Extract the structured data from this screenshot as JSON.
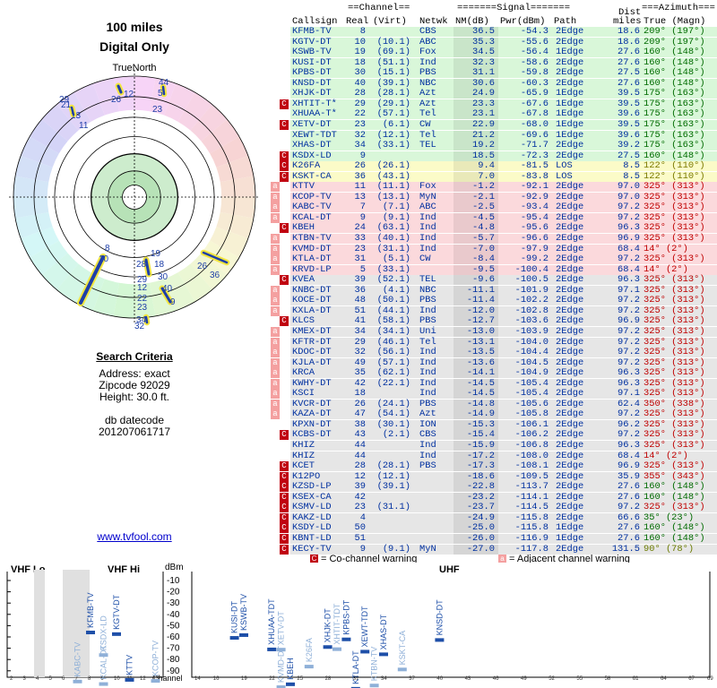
{
  "title": "100 miles",
  "subtitle": "Digital Only",
  "truenorth_label": "TrueNorth",
  "search": {
    "heading": "Search Criteria",
    "address": "Address: exact",
    "zipcode": "Zipcode 92029",
    "height": "Height: 30.0 ft.",
    "db_label": "db datecode",
    "db_value": "201207061717"
  },
  "site_link": "www.tvfool.com",
  "columns": {
    "group_channel": "==Channel==",
    "group_signal": "=======Signal=======",
    "group_azimuth": "===Azimuth===",
    "callsign": "Callsign",
    "real": "Real",
    "virt": "(Virt)",
    "netwk": "Netwk",
    "nm": "NM(dB)",
    "pwr": "Pwr(dBm)",
    "path": "Path",
    "dist1": "Dist",
    "dist2": "miles",
    "true_magn": "True (Magn)"
  },
  "colors": {
    "green": "#d9f7d9",
    "yellow": "#fbfbc8",
    "pink": "#fbd9dc",
    "gray": "#e6e6e6",
    "badge_co": "#c0000f",
    "badge_adj": "#f4a0a0"
  },
  "stations": [
    {
      "call": "KFMB-TV",
      "real": "8",
      "virt": "",
      "net": "CBS",
      "nm": "36.5",
      "pwr": "-54.3",
      "path": "2Edge",
      "dist": "18.6",
      "az": "209° (197°)",
      "band": "green",
      "badge": ""
    },
    {
      "call": "KGTV-DT",
      "real": "10",
      "virt": "(10.1)",
      "net": "ABC",
      "nm": "35.3",
      "pwr": "-55.6",
      "path": "2Edge",
      "dist": "18.6",
      "az": "209° (197°)",
      "band": "green",
      "badge": ""
    },
    {
      "call": "KSWB-TV",
      "real": "19",
      "virt": "(69.1)",
      "net": "Fox",
      "nm": "34.5",
      "pwr": "-56.4",
      "path": "1Edge",
      "dist": "27.6",
      "az": "160° (148°)",
      "band": "green",
      "badge": ""
    },
    {
      "call": "KUSI-DT",
      "real": "18",
      "virt": "(51.1)",
      "net": "Ind",
      "nm": "32.3",
      "pwr": "-58.6",
      "path": "2Edge",
      "dist": "27.6",
      "az": "160° (148°)",
      "band": "green",
      "badge": ""
    },
    {
      "call": "KPBS-DT",
      "real": "30",
      "virt": "(15.1)",
      "net": "PBS",
      "nm": "31.1",
      "pwr": "-59.8",
      "path": "2Edge",
      "dist": "27.5",
      "az": "160° (148°)",
      "band": "green",
      "badge": ""
    },
    {
      "call": "KNSD-DT",
      "real": "40",
      "virt": "(39.1)",
      "net": "NBC",
      "nm": "30.6",
      "pwr": "-60.3",
      "path": "2Edge",
      "dist": "27.6",
      "az": "160° (148°)",
      "band": "green",
      "badge": ""
    },
    {
      "call": "XHJK-DT",
      "real": "28",
      "virt": "(28.1)",
      "net": "Azt",
      "nm": "24.9",
      "pwr": "-65.9",
      "path": "1Edge",
      "dist": "39.5",
      "az": "175° (163°)",
      "band": "green",
      "badge": ""
    },
    {
      "call": "XHTIT-T*",
      "real": "29",
      "virt": "(29.1)",
      "net": "Azt",
      "nm": "23.3",
      "pwr": "-67.6",
      "path": "1Edge",
      "dist": "39.5",
      "az": "175° (163°)",
      "band": "green",
      "badge": "co"
    },
    {
      "call": "XHUAA-T*",
      "real": "22",
      "virt": "(57.1)",
      "net": "Tel",
      "nm": "23.1",
      "pwr": "-67.8",
      "path": "1Edge",
      "dist": "39.6",
      "az": "175° (163°)",
      "band": "green",
      "badge": ""
    },
    {
      "call": "XETV-DT",
      "real": "23",
      "virt": "(6.1)",
      "net": "CW",
      "nm": "22.9",
      "pwr": "-68.0",
      "path": "1Edge",
      "dist": "39.5",
      "az": "175° (163°)",
      "band": "green",
      "badge": "co"
    },
    {
      "call": "XEWT-TDT",
      "real": "32",
      "virt": "(12.1)",
      "net": "Tel",
      "nm": "21.2",
      "pwr": "-69.6",
      "path": "1Edge",
      "dist": "39.6",
      "az": "175° (163°)",
      "band": "green",
      "badge": ""
    },
    {
      "call": "XHAS-DT",
      "real": "34",
      "virt": "(33.1)",
      "net": "TEL",
      "nm": "19.2",
      "pwr": "-71.7",
      "path": "2Edge",
      "dist": "39.2",
      "az": "175° (163°)",
      "band": "green",
      "badge": ""
    },
    {
      "call": "KSDX-LD",
      "real": "9",
      "virt": "",
      "net": "",
      "nm": "18.5",
      "pwr": "-72.3",
      "path": "2Edge",
      "dist": "27.5",
      "az": "160° (148°)",
      "band": "green",
      "badge": "co"
    },
    {
      "call": "K26FA",
      "real": "26",
      "virt": "(26.1)",
      "net": "",
      "nm": "9.4",
      "pwr": "-81.5",
      "path": "LOS",
      "dist": "8.5",
      "az": "122° (110°)",
      "band": "yellow",
      "badge": "co"
    },
    {
      "call": "KSKT-CA",
      "real": "36",
      "virt": "(43.1)",
      "net": "",
      "nm": "7.0",
      "pwr": "-83.8",
      "path": "LOS",
      "dist": "8.5",
      "az": "122° (110°)",
      "band": "yellow",
      "badge": "co"
    },
    {
      "call": "KTTV",
      "real": "11",
      "virt": "(11.1)",
      "net": "Fox",
      "nm": "-1.2",
      "pwr": "-92.1",
      "path": "2Edge",
      "dist": "97.0",
      "az": "325° (313°)",
      "band": "pink",
      "badge": "adj"
    },
    {
      "call": "KCOP-TV",
      "real": "13",
      "virt": "(13.1)",
      "net": "MyN",
      "nm": "-2.1",
      "pwr": "-92.9",
      "path": "2Edge",
      "dist": "97.0",
      "az": "325° (313°)",
      "band": "pink",
      "badge": "adj"
    },
    {
      "call": "KABC-TV",
      "real": "7",
      "virt": "(7.1)",
      "net": "ABC",
      "nm": "-2.5",
      "pwr": "-93.4",
      "path": "2Edge",
      "dist": "97.2",
      "az": "325° (313°)",
      "band": "pink",
      "badge": "adj"
    },
    {
      "call": "KCAL-DT",
      "real": "9",
      "virt": "(9.1)",
      "net": "Ind",
      "nm": "-4.5",
      "pwr": "-95.4",
      "path": "2Edge",
      "dist": "97.2",
      "az": "325° (313°)",
      "band": "pink",
      "badge": "adj"
    },
    {
      "call": "KBEH",
      "real": "24",
      "virt": "(63.1)",
      "net": "Ind",
      "nm": "-4.8",
      "pwr": "-95.6",
      "path": "2Edge",
      "dist": "96.3",
      "az": "325° (313°)",
      "band": "pink",
      "badge": "co"
    },
    {
      "call": "KTBN-TV",
      "real": "33",
      "virt": "(40.1)",
      "net": "Ind",
      "nm": "-5.7",
      "pwr": "-96.6",
      "path": "2Edge",
      "dist": "96.9",
      "az": "325° (313°)",
      "band": "pink",
      "badge": "adj"
    },
    {
      "call": "KVMD-DT",
      "real": "23",
      "virt": "(31.1)",
      "net": "Ind",
      "nm": "-7.0",
      "pwr": "-97.9",
      "path": "2Edge",
      "dist": "68.4",
      "az": "14° (2°)",
      "band": "pink",
      "badge": "adj"
    },
    {
      "call": "KTLA-DT",
      "real": "31",
      "virt": "(5.1)",
      "net": "CW",
      "nm": "-8.4",
      "pwr": "-99.2",
      "path": "2Edge",
      "dist": "97.2",
      "az": "325° (313°)",
      "band": "pink",
      "badge": "adj"
    },
    {
      "call": "KRVD-LP",
      "real": "5",
      "virt": "(33.1)",
      "net": "",
      "nm": "-9.5",
      "pwr": "-100.4",
      "path": "2Edge",
      "dist": "68.4",
      "az": "14° (2°)",
      "band": "pink",
      "badge": "adj"
    },
    {
      "call": "KVEA",
      "real": "39",
      "virt": "(52.1)",
      "net": "TEL",
      "nm": "-9.6",
      "pwr": "-100.5",
      "path": "2Edge",
      "dist": "96.3",
      "az": "325° (313°)",
      "band": "gray",
      "badge": "co"
    },
    {
      "call": "KNBC-DT",
      "real": "36",
      "virt": "(4.1)",
      "net": "NBC",
      "nm": "-11.1",
      "pwr": "-101.9",
      "path": "2Edge",
      "dist": "97.1",
      "az": "325° (313°)",
      "band": "gray",
      "badge": "adj"
    },
    {
      "call": "KOCE-DT",
      "real": "48",
      "virt": "(50.1)",
      "net": "PBS",
      "nm": "-11.4",
      "pwr": "-102.2",
      "path": "2Edge",
      "dist": "97.2",
      "az": "325° (313°)",
      "band": "gray",
      "badge": "adj"
    },
    {
      "call": "KXLA-DT",
      "real": "51",
      "virt": "(44.1)",
      "net": "Ind",
      "nm": "-12.0",
      "pwr": "-102.8",
      "path": "2Edge",
      "dist": "97.2",
      "az": "325° (313°)",
      "band": "gray",
      "badge": "adj"
    },
    {
      "call": "KLCS",
      "real": "41",
      "virt": "(58.1)",
      "net": "PBS",
      "nm": "-12.7",
      "pwr": "-103.6",
      "path": "2Edge",
      "dist": "96.9",
      "az": "325° (313°)",
      "band": "gray",
      "badge": "co"
    },
    {
      "call": "KMEX-DT",
      "real": "34",
      "virt": "(34.1)",
      "net": "Uni",
      "nm": "-13.0",
      "pwr": "-103.9",
      "path": "2Edge",
      "dist": "97.2",
      "az": "325° (313°)",
      "band": "gray",
      "badge": "adj"
    },
    {
      "call": "KFTR-DT",
      "real": "29",
      "virt": "(46.1)",
      "net": "Tel",
      "nm": "-13.1",
      "pwr": "-104.0",
      "path": "2Edge",
      "dist": "97.2",
      "az": "325° (313°)",
      "band": "gray",
      "badge": "adj"
    },
    {
      "call": "KDOC-DT",
      "real": "32",
      "virt": "(56.1)",
      "net": "Ind",
      "nm": "-13.5",
      "pwr": "-104.4",
      "path": "2Edge",
      "dist": "97.2",
      "az": "325° (313°)",
      "band": "gray",
      "badge": "adj"
    },
    {
      "call": "KJLA-DT",
      "real": "49",
      "virt": "(57.1)",
      "net": "Ind",
      "nm": "-13.6",
      "pwr": "-104.5",
      "path": "2Edge",
      "dist": "97.2",
      "az": "325° (313°)",
      "band": "gray",
      "badge": "adj"
    },
    {
      "call": "KRCA",
      "real": "35",
      "virt": "(62.1)",
      "net": "Ind",
      "nm": "-14.1",
      "pwr": "-104.9",
      "path": "2Edge",
      "dist": "96.3",
      "az": "325° (313°)",
      "band": "gray",
      "badge": "adj"
    },
    {
      "call": "KWHY-DT",
      "real": "42",
      "virt": "(22.1)",
      "net": "Ind",
      "nm": "-14.5",
      "pwr": "-105.4",
      "path": "2Edge",
      "dist": "96.3",
      "az": "325° (313°)",
      "band": "gray",
      "badge": "adj"
    },
    {
      "call": "KSCI",
      "real": "18",
      "virt": "",
      "net": "Ind",
      "nm": "-14.5",
      "pwr": "-105.4",
      "path": "2Edge",
      "dist": "97.1",
      "az": "325° (313°)",
      "band": "gray",
      "badge": "adj"
    },
    {
      "call": "KVCR-DT",
      "real": "26",
      "virt": "(24.1)",
      "net": "PBS",
      "nm": "-14.8",
      "pwr": "-105.6",
      "path": "2Edge",
      "dist": "62.4",
      "az": "350° (338°)",
      "band": "gray",
      "badge": "adj"
    },
    {
      "call": "KAZA-DT",
      "real": "47",
      "virt": "(54.1)",
      "net": "Azt",
      "nm": "-14.9",
      "pwr": "-105.8",
      "path": "2Edge",
      "dist": "97.2",
      "az": "325° (313°)",
      "band": "gray",
      "badge": "adj"
    },
    {
      "call": "KPXN-DT",
      "real": "38",
      "virt": "(30.1)",
      "net": "ION",
      "nm": "-15.3",
      "pwr": "-106.1",
      "path": "2Edge",
      "dist": "96.2",
      "az": "325° (313°)",
      "band": "gray",
      "badge": ""
    },
    {
      "call": "KCBS-DT",
      "real": "43",
      "virt": "(2.1)",
      "net": "CBS",
      "nm": "-15.4",
      "pwr": "-106.2",
      "path": "2Edge",
      "dist": "97.2",
      "az": "325° (313°)",
      "band": "gray",
      "badge": "co"
    },
    {
      "call": "KHIZ",
      "real": "44",
      "virt": "",
      "net": "Ind",
      "nm": "-15.9",
      "pwr": "-106.8",
      "path": "2Edge",
      "dist": "96.3",
      "az": "325° (313°)",
      "band": "gray",
      "badge": ""
    },
    {
      "call": "KHIZ",
      "real": "44",
      "virt": "",
      "net": "Ind",
      "nm": "-17.2",
      "pwr": "-108.0",
      "path": "2Edge",
      "dist": "68.4",
      "az": "14° (2°)",
      "band": "gray",
      "badge": ""
    },
    {
      "call": "KCET",
      "real": "28",
      "virt": "(28.1)",
      "net": "PBS",
      "nm": "-17.3",
      "pwr": "-108.1",
      "path": "2Edge",
      "dist": "96.9",
      "az": "325° (313°)",
      "band": "gray",
      "badge": "co"
    },
    {
      "call": "K12PO",
      "real": "12",
      "virt": "(12.1)",
      "net": "",
      "nm": "-18.6",
      "pwr": "-109.5",
      "path": "2Edge",
      "dist": "35.9",
      "az": "355° (343°)",
      "band": "gray",
      "badge": "co"
    },
    {
      "call": "KZSD-LP",
      "real": "39",
      "virt": "(39.1)",
      "net": "",
      "nm": "-22.8",
      "pwr": "-113.7",
      "path": "2Edge",
      "dist": "27.6",
      "az": "160° (148°)",
      "band": "gray",
      "badge": "co"
    },
    {
      "call": "KSEX-CA",
      "real": "42",
      "virt": "",
      "net": "",
      "nm": "-23.2",
      "pwr": "-114.1",
      "path": "2Edge",
      "dist": "27.6",
      "az": "160° (148°)",
      "band": "gray",
      "badge": "co"
    },
    {
      "call": "KSMV-LD",
      "real": "23",
      "virt": "(31.1)",
      "net": "",
      "nm": "-23.7",
      "pwr": "-114.5",
      "path": "2Edge",
      "dist": "97.2",
      "az": "325° (313°)",
      "band": "gray",
      "badge": "co"
    },
    {
      "call": "KAKZ-LD",
      "real": "4",
      "virt": "",
      "net": "",
      "nm": "-24.9",
      "pwr": "-115.8",
      "path": "2Edge",
      "dist": "66.6",
      "az": "35° (23°)",
      "band": "gray",
      "badge": "co"
    },
    {
      "call": "KSDY-LD",
      "real": "50",
      "virt": "",
      "net": "",
      "nm": "-25.0",
      "pwr": "-115.8",
      "path": "1Edge",
      "dist": "27.6",
      "az": "160° (148°)",
      "band": "gray",
      "badge": "co"
    },
    {
      "call": "KBNT-LD",
      "real": "51",
      "virt": "",
      "net": "",
      "nm": "-26.0",
      "pwr": "-116.9",
      "path": "1Edge",
      "dist": "27.6",
      "az": "160° (148°)",
      "band": "gray",
      "badge": "co"
    },
    {
      "call": "KECY-TV",
      "real": "9",
      "virt": "(9.1)",
      "net": "MyN",
      "nm": "-27.0",
      "pwr": "-117.8",
      "path": "2Edge",
      "dist": "131.5",
      "az": "90° (78°)",
      "band": "gray",
      "badge": "co"
    }
  ],
  "polar": {
    "labels": [
      {
        "text": "44",
        "angle": 18,
        "r": 0.98
      },
      {
        "text": "5",
        "angle": 18,
        "r": 0.93
      },
      {
        "text": "26",
        "angle": -8,
        "r": 0.92
      },
      {
        "text": "12",
        "angle": 3,
        "r": 0.92
      },
      {
        "text": "29",
        "angle": -38,
        "r": 0.88
      },
      {
        "text": "21",
        "angle": -36,
        "r": 0.85
      },
      {
        "text": "13",
        "angle": -40,
        "r": 0.78
      },
      {
        "text": "11",
        "angle": -44,
        "r": 0.66
      },
      {
        "text": "23",
        "angle": 15,
        "r": 0.75
      },
      {
        "text": "26",
        "angle": 118,
        "r": 0.92
      },
      {
        "text": "36",
        "angle": 120,
        "r": 0.97
      },
      {
        "text": "8",
        "angle": -170,
        "r": 0.63
      },
      {
        "text": "10",
        "angle": -168,
        "r": 0.56
      },
      {
        "text": "19",
        "angle": 160,
        "r": 0.48
      },
      {
        "text": "18",
        "angle": 160,
        "r": 0.52
      },
      {
        "text": "28",
        "angle": -176,
        "r": 0.55
      },
      {
        "text": "29",
        "angle": -176,
        "r": 0.63
      },
      {
        "text": "12",
        "angle": -175,
        "r": 0.7
      },
      {
        "text": "22",
        "angle": -175,
        "r": 0.79
      },
      {
        "text": "23",
        "angle": -175,
        "r": 0.88
      },
      {
        "text": "34",
        "angle": -175,
        "r": 0.96
      },
      {
        "text": "32",
        "angle": -175,
        "r": 1.0
      },
      {
        "text": "30",
        "angle": 165,
        "r": 0.66
      },
      {
        "text": "40",
        "angle": 160,
        "r": 0.76
      },
      {
        "text": "9",
        "angle": 157,
        "r": 0.93
      }
    ]
  },
  "spectrum": {
    "vhf_lo_label": "VHF Lo",
    "vhf_hi_label": "VHF Hi",
    "uhf_label": "UHF",
    "dbm_label": "dBm",
    "channel_label": "Channel",
    "y_ticks": [
      "-10",
      "-20",
      "-30",
      "-40",
      "-50",
      "-60",
      "-70",
      "-80",
      "-90"
    ],
    "vhf_ticks": [
      "2",
      "3",
      "4",
      "5",
      "6",
      "7",
      "8",
      "9",
      "10",
      "11",
      "12",
      "13"
    ],
    "uhf_ticks": [
      "14",
      "16",
      "19",
      "22",
      "25",
      "28",
      "31",
      "34",
      "37",
      "40",
      "43",
      "46",
      "49",
      "52",
      "55",
      "58",
      "61",
      "64",
      "67",
      "69"
    ],
    "legend_co": "= Co-channel warning",
    "legend_adj": "= Adjacent channel warning",
    "legend_co_glyph": "C",
    "legend_adj_glyph": "a",
    "vhf_stations": [
      {
        "call": "KFMB-TV",
        "ch": 8,
        "pwr": -54.3,
        "strong": true
      },
      {
        "call": "KGTV-DT",
        "ch": 10,
        "pwr": -55.6,
        "strong": true
      },
      {
        "call": "KTTV",
        "ch": 11,
        "pwr": -92.1,
        "strong": true
      },
      {
        "call": "KABC-TV",
        "ch": 7,
        "pwr": -93.4,
        "strong": false
      },
      {
        "call": "KCAL-DT",
        "ch": 9,
        "pwr": -95.4,
        "strong": false
      },
      {
        "call": "KSDX-LD",
        "ch": 9,
        "pwr": -72.3,
        "strong": false
      },
      {
        "call": "KCOP-TV",
        "ch": 13,
        "pwr": -92.9,
        "strong": false
      }
    ],
    "uhf_stations": [
      {
        "call": "KUSI-DT",
        "ch": 18,
        "pwr": -58.6,
        "strong": true
      },
      {
        "call": "KSWB-TV",
        "ch": 19,
        "pwr": -56.4,
        "strong": true
      },
      {
        "call": "XHUAA-TDT",
        "ch": 22,
        "pwr": -67.8,
        "strong": true
      },
      {
        "call": "XETV-DT",
        "ch": 23,
        "pwr": -68.0,
        "strong": false
      },
      {
        "call": "KVMD-DT",
        "ch": 23,
        "pwr": -97.9,
        "strong": false
      },
      {
        "call": "KBEH",
        "ch": 24,
        "pwr": -95.6,
        "strong": true
      },
      {
        "call": "K26FA",
        "ch": 26,
        "pwr": -81.5,
        "strong": false
      },
      {
        "call": "XHJK-DT",
        "ch": 28,
        "pwr": -65.9,
        "strong": true
      },
      {
        "call": "XHTIT-TDT",
        "ch": 29,
        "pwr": -67.6,
        "strong": false
      },
      {
        "call": "KPBS-DT",
        "ch": 30,
        "pwr": -59.8,
        "strong": true
      },
      {
        "call": "KTLA-DT",
        "ch": 31,
        "pwr": -99.2,
        "strong": true
      },
      {
        "call": "XEWT-TDT",
        "ch": 32,
        "pwr": -69.6,
        "strong": true
      },
      {
        "call": "KTBN-TV",
        "ch": 33,
        "pwr": -96.6,
        "strong": false
      },
      {
        "call": "XHAS-DT",
        "ch": 34,
        "pwr": -71.7,
        "strong": true
      },
      {
        "call": "KSKT-CA",
        "ch": 36,
        "pwr": -83.8,
        "strong": false
      },
      {
        "call": "KNSD-DT",
        "ch": 40,
        "pwr": -60.3,
        "strong": true
      }
    ]
  }
}
